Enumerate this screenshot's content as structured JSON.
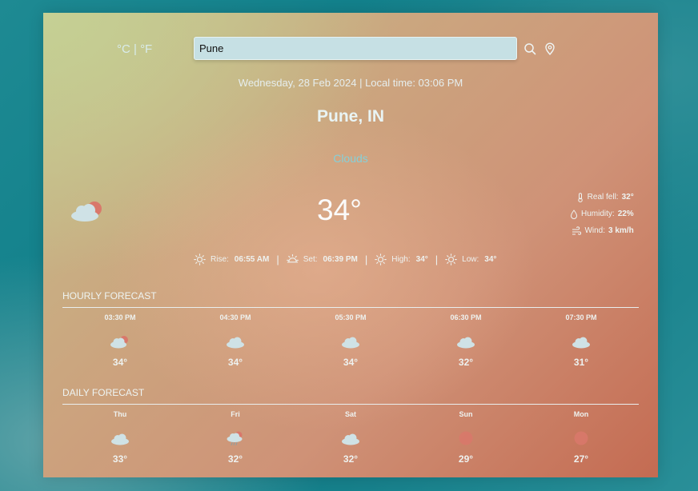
{
  "units_toggle": "°C | °F",
  "search": {
    "value": "Pune"
  },
  "date_line": "Wednesday, 28 Feb 2024 | Local time: 03:06 PM",
  "city": "Pune, IN",
  "condition": "Clouds",
  "current": {
    "temperature": "34°",
    "icon": "cloud-with-sun-icon",
    "details": [
      {
        "label": "Real fell:",
        "value": "32°",
        "icon": "thermometer-icon"
      },
      {
        "label": "Humidity:",
        "value": "22%",
        "icon": "droplet-icon"
      },
      {
        "label": "Wind:",
        "value": "3 km/h",
        "icon": "wind-icon"
      }
    ]
  },
  "sun": [
    {
      "label": "Rise:",
      "value": "06:55 AM",
      "icon": "sunrise-icon"
    },
    {
      "label": "Set:",
      "value": "06:39 PM",
      "icon": "sunset-icon"
    },
    {
      "label": "High:",
      "value": "34°",
      "icon": "sun-icon"
    },
    {
      "label": "Low:",
      "value": "34°",
      "icon": "sun-icon"
    }
  ],
  "hourly": {
    "title": "HOURLY FORECAST",
    "items": [
      {
        "label": "03:30 PM",
        "temp": "34°",
        "icon": "cloud-with-sun-icon"
      },
      {
        "label": "04:30 PM",
        "temp": "34°",
        "icon": "cloud-icon"
      },
      {
        "label": "05:30 PM",
        "temp": "34°",
        "icon": "cloud-icon"
      },
      {
        "label": "06:30 PM",
        "temp": "32°",
        "icon": "cloud-icon"
      },
      {
        "label": "07:30 PM",
        "temp": "31°",
        "icon": "cloud-icon"
      }
    ]
  },
  "daily": {
    "title": "DAILY FORECAST",
    "items": [
      {
        "label": "Thu",
        "temp": "33°",
        "icon": "cloud-icon"
      },
      {
        "label": "Fri",
        "temp": "32°",
        "icon": "rain-cloud-icon"
      },
      {
        "label": "Sat",
        "temp": "32°",
        "icon": "cloud-icon"
      },
      {
        "label": "Sun",
        "temp": "29°",
        "icon": "sun-disc-icon"
      },
      {
        "label": "Mon",
        "temp": "27°",
        "icon": "sun-disc-icon"
      }
    ]
  },
  "colors": {
    "sun_disc": "#d9786b",
    "cloud": "#cfe2e6",
    "accent": "#86d0d8"
  }
}
